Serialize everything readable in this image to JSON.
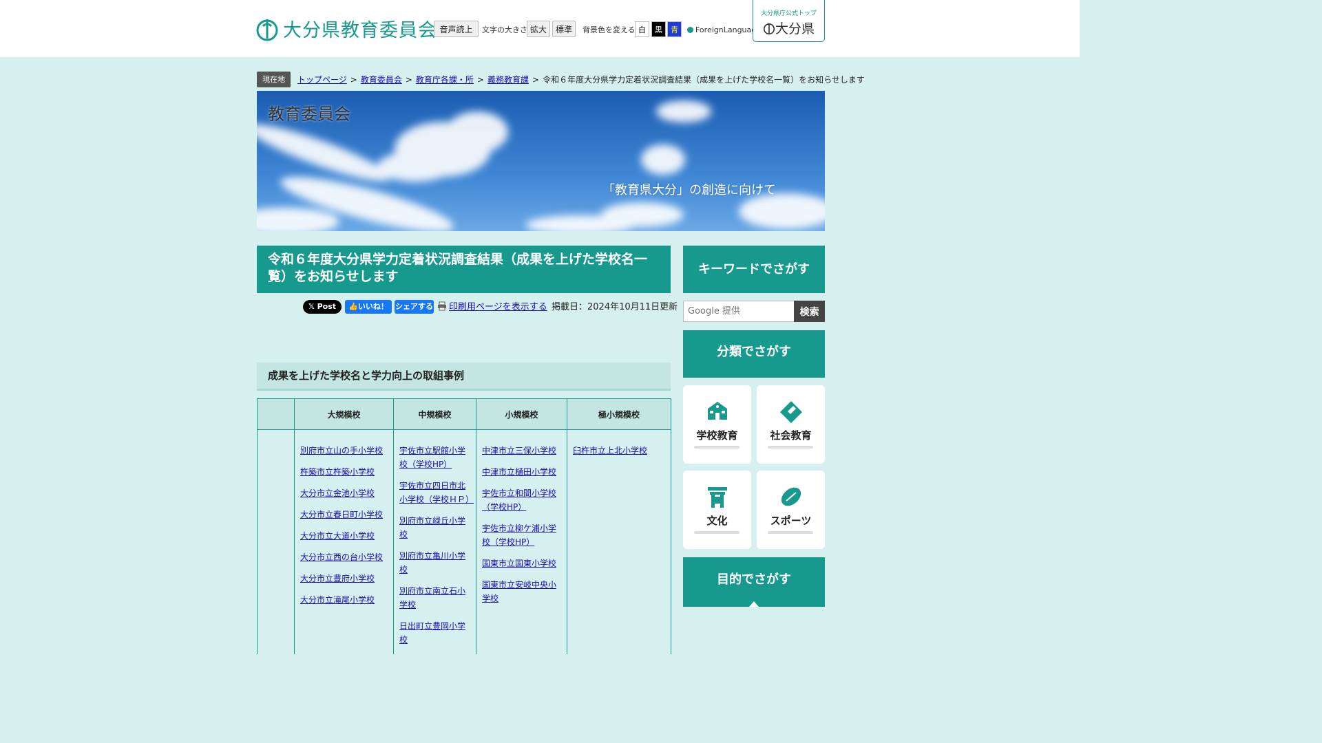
{
  "header": {
    "site_title": "大分県教育委員会",
    "read_aloud": "音声読上",
    "text_size_label": "文字の大きさ",
    "enlarge": "拡大",
    "standard": "標準",
    "bg_color_label": "背景色を変える",
    "bg_white": "白",
    "bg_black": "黒",
    "bg_blue": "青",
    "foreign_language": "ForeignLanguage",
    "pref_top_small": "大分県庁公式トップ",
    "pref_top_big": "大分県",
    "brand_color": "#17998d"
  },
  "breadcrumb": {
    "tag": "現在地",
    "items": [
      "トップページ",
      "教育委員会",
      "教育庁各課・所",
      "義務教育課"
    ],
    "current": "令和６年度大分県学力定着状況調査結果（成果を上げた学校名一覧）をお知らせします"
  },
  "banner": {
    "title": "教育委員会",
    "caption": "「教育県大分」の創造に向けて"
  },
  "article": {
    "title": "令和６年度大分県学力定着状況調査結果（成果を上げた学校名一覧）をお知らせします",
    "x_post": "Post",
    "fb_like": "いいね！",
    "fb_share": "シェアする",
    "print_link": "印刷用ページを表示する",
    "updated": "掲載日：2024年10月11日更新",
    "section_heading": "成果を上げた学校名と学力向上の取組事例"
  },
  "table": {
    "headers": [
      "",
      "大規模校",
      "中規模校",
      "小規模校",
      "極小規模校"
    ],
    "large": [
      "別府市立山の手小学校",
      "杵築市立杵築小学校",
      "大分市立金池小学校",
      "大分市立春日町小学校",
      "大分市立大道小学校",
      "大分市立西の台小学校",
      "大分市立豊府小学校",
      "大分市立滝尾小学校"
    ],
    "medium": [
      "宇佐市立駅館小学校（学校HP）",
      "宇佐市立四日市北小学校（学校ＨＰ）",
      "別府市立緑丘小学校",
      "別府市立亀川小学校",
      "別府市立南立石小学校",
      "日出町立豊岡小学校"
    ],
    "small": [
      "中津市立三保小学校",
      "中津市立樋田小学校",
      "宇佐市立和間小学校（学校HP）",
      "宇佐市立柳ケ浦小学校（学校HP）",
      "国東市立国東小学校",
      "国東市立安岐中央小学校"
    ],
    "tiny": [
      "臼杵市立上北小学校"
    ]
  },
  "sidebar": {
    "keyword_search": "キーワードでさがす",
    "search_placeholder": "Google 提供",
    "search_button": "検索",
    "category_search": "分類でさがす",
    "tiles": [
      "学校教育",
      "社会教育",
      "文化",
      "スポーツ"
    ],
    "purpose_search": "目的でさがす"
  }
}
